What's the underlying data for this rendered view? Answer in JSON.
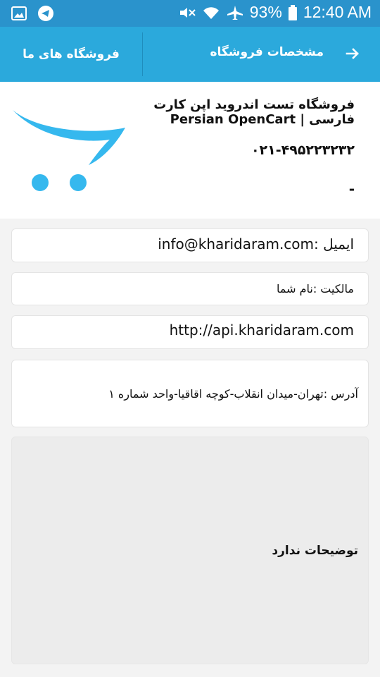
{
  "status_bar": {
    "battery": "93%",
    "time": "12:40 AM",
    "icons": [
      "gallery-icon",
      "telegram-icon",
      "mute-icon",
      "wifi-icon",
      "airplane-icon",
      "battery-icon"
    ]
  },
  "toolbar": {
    "title": "مشخصات فروشگاه",
    "stores_link": "فروشگاه های ما",
    "back_icon": "arrow-icon"
  },
  "store": {
    "name": "فروشگاه تست اندروید اپن کارت فارسی | Persian OpenCart",
    "phone": "۰۲۱-۴۹۵۲۲۳۲۳۲",
    "extra": "-"
  },
  "details": {
    "email": "ایمیل :info@kharidaram.com",
    "owner": "مالکیت :نام شما",
    "website": "http://api.kharidaram.com",
    "address": "آدرس :تهران-میدان انقلاب-کوچه اقاقیا-واحد شماره ۱",
    "description": "توضیحات ندارد"
  },
  "colors": {
    "status_bar": "#2a93cc",
    "toolbar": "#2ba9dc",
    "logo_blue": "#35b8ee"
  }
}
